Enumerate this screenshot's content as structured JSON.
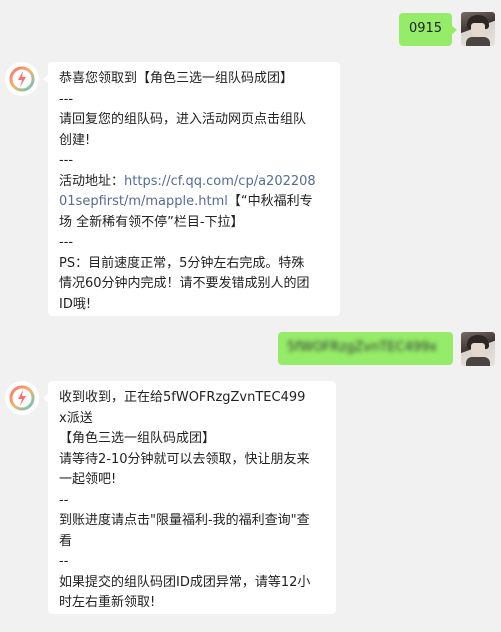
{
  "messages": [
    {
      "sender": "me",
      "text": "0915"
    },
    {
      "sender": "bot",
      "lines": [
        "恭喜您领取到【角色三选一组队码成团】",
        "---",
        "请回复您的组队码，进入活动网页点击组队",
        "创建!",
        "---"
      ],
      "link_prefix": "活动地址：",
      "link_line1": "https://cf.qq.com/cp/a202208",
      "link_line2": "01sepfirst/m/mapple.html",
      "link_suffix": "【“中秋福利专",
      "lines_after": [
        "场 全新稀有领不停”栏目-下拉】",
        "---",
        "PS：目前速度正常，5分钟左右完成。特殊",
        "情况60分钟内完成！请不要发错成别人的团",
        "ID哦!"
      ]
    },
    {
      "sender": "me",
      "text": "5fWOFRzgZvnTEC499x",
      "redacted": true
    },
    {
      "sender": "bot",
      "lines": [
        "收到收到，正在给5fWOFRzgZvnTEC499",
        "x派送",
        "【角色三选一组队码成团】",
        "请等待2-10分钟就可以去领取，快让朋友来",
        "一起领吧!",
        "--",
        "到账进度请点击\"限量福利-我的福利查询\"查",
        "看",
        "--",
        "如果提交的组队码团ID成团异常，请等12小",
        "时左右重新领取!"
      ]
    }
  ],
  "colors": {
    "background": "#f1f1f1",
    "my_bubble": "#95ec69",
    "their_bubble": "#ffffff",
    "link": "#576b95"
  },
  "icons": {
    "bot_avatar": "lightning-ring-icon",
    "user_avatar": "anime-character-avatar"
  }
}
